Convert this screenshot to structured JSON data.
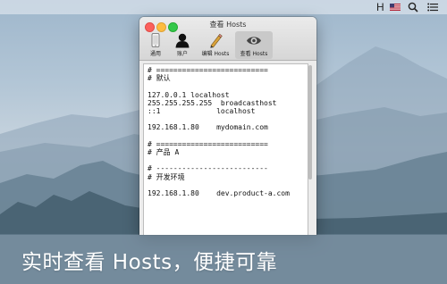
{
  "menubar": {
    "input_indicator": "H",
    "icons": [
      "us-flag-icon",
      "search-icon",
      "list-icon"
    ]
  },
  "window": {
    "title": "查看 Hosts",
    "toolbar": [
      {
        "label": "通用",
        "icon": "phone-icon",
        "active": false
      },
      {
        "label": "账户",
        "icon": "user-icon",
        "active": false
      },
      {
        "label": "编辑 Hosts",
        "icon": "pencil-icon",
        "active": false
      },
      {
        "label": "查看 Hosts",
        "icon": "eye-icon",
        "active": true
      }
    ],
    "hosts_content": "# ==========================\n# 默认\n\n127.0.0.1 localhost\n255.255.255.255  broadcasthost\n::1             localhost\n\n192.168.1.80    mydomain.com\n\n# ==========================\n# 产品 A\n\n# --------------------------\n# 开发环境\n\n192.168.1.80    dev.product-a.com"
  },
  "banner": {
    "text": "实时查看 Hosts，便捷可靠"
  },
  "colors": {
    "close": "#fc605c",
    "minimize": "#fdbc40",
    "maximize": "#34c84a"
  }
}
